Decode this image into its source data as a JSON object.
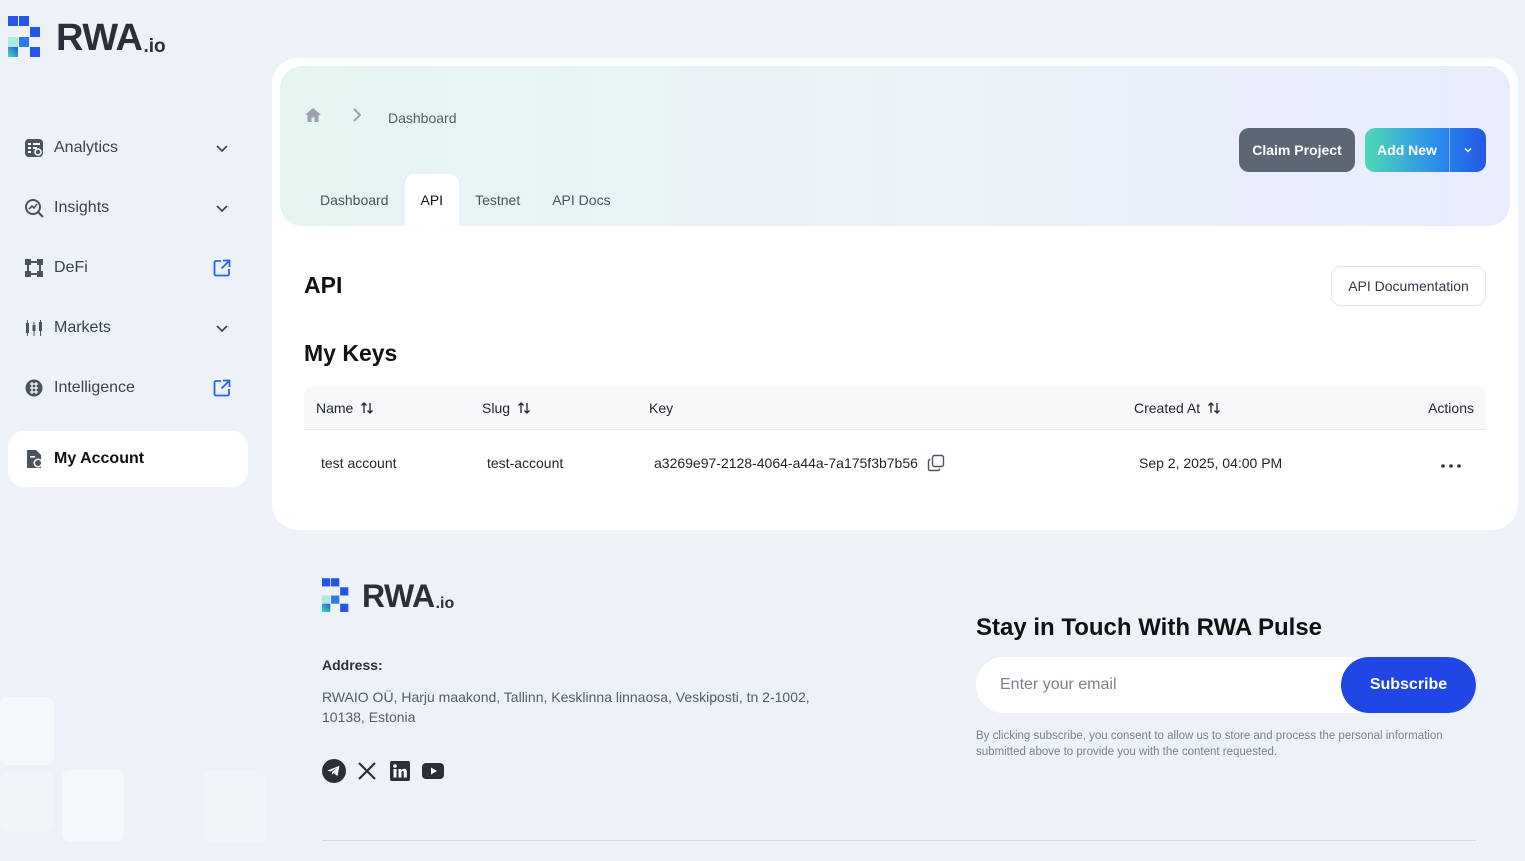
{
  "brand": {
    "name": "RWA",
    "suffix": ".io"
  },
  "sidebar": {
    "items": [
      {
        "label": "Analytics",
        "icon": "analytics-icon",
        "trail": "chevron-down-icon"
      },
      {
        "label": "Insights",
        "icon": "insights-icon",
        "trail": "chevron-down-icon"
      },
      {
        "label": "DeFi",
        "icon": "defi-icon",
        "trail": "external-link-icon"
      },
      {
        "label": "Markets",
        "icon": "markets-icon",
        "trail": "chevron-down-icon"
      },
      {
        "label": "Intelligence",
        "icon": "intelligence-icon",
        "trail": "external-link-icon"
      },
      {
        "label": "My Account",
        "icon": "account-icon",
        "active": true
      }
    ]
  },
  "header": {
    "breadcrumb": {
      "current": "Dashboard"
    },
    "claim_label": "Claim Project",
    "add_label": "Add New",
    "tabs": [
      {
        "label": "Dashboard",
        "active": false
      },
      {
        "label": "API",
        "active": true
      },
      {
        "label": "Testnet",
        "active": false
      },
      {
        "label": "API Docs",
        "active": false
      }
    ]
  },
  "main": {
    "title": "API",
    "doc_button": "API Documentation",
    "section_title": "My Keys",
    "table": {
      "columns": [
        "Name",
        "Slug",
        "Key",
        "Created At",
        "Actions"
      ],
      "rows": [
        {
          "name": "test account",
          "slug": "test-account",
          "key": "a3269e97-2128-4064-a44a-7a175f3b7b56",
          "created_at": "Sep 2, 2025, 04:00 PM",
          "actions": "..."
        }
      ]
    }
  },
  "footer": {
    "address_label": "Address:",
    "address": "RWAIO OÜ, Harju maakond, Tallinn, Kesklinna linnaosa, Veskiposti, tn 2-1002, 10138, Estonia",
    "socials": [
      "telegram-icon",
      "x-icon",
      "linkedin-icon",
      "youtube-icon"
    ],
    "newsletter": {
      "title": "Stay in Touch With RWA Pulse",
      "placeholder": "Enter your email",
      "button": "Subscribe",
      "consent": "By clicking subscribe, you consent to allow us to store and process the personal information submitted above to provide you with the content requested."
    }
  },
  "colors": {
    "background": "#edf2f8",
    "primary": "#2146e6",
    "accent_teal": "#4fd8b7",
    "claim_button": "#5d6673",
    "link_icon": "#2563eb"
  }
}
